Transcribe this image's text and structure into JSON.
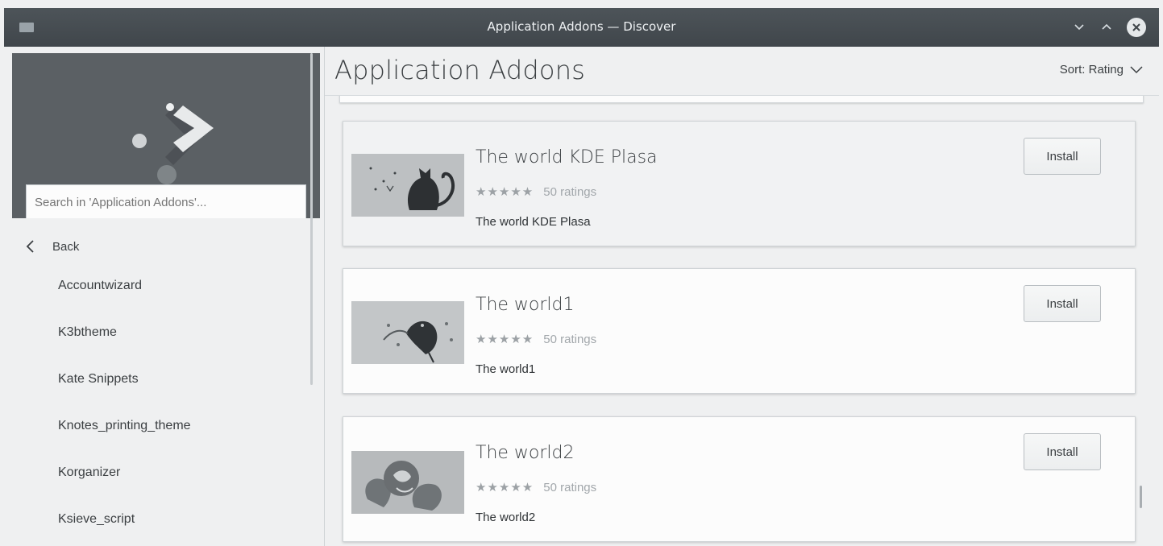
{
  "window": {
    "title": "Application Addons — Discover"
  },
  "sidebar": {
    "search_placeholder": "Search in 'Application Addons'...",
    "back_label": "Back",
    "categories": [
      {
        "label": "Accountwizard"
      },
      {
        "label": "K3btheme"
      },
      {
        "label": "Kate Snippets"
      },
      {
        "label": "Knotes_printing_theme"
      },
      {
        "label": "Korganizer"
      },
      {
        "label": "Ksieve_script"
      }
    ]
  },
  "main": {
    "title": "Application Addons",
    "sort_label": "Sort: Rating",
    "items": [
      {
        "name": "The world KDE Plasa",
        "ratings": "50 ratings",
        "summary": "The world KDE Plasa",
        "install_label": "Install",
        "stars": "★★★★★"
      },
      {
        "name": "The world1",
        "ratings": "50 ratings",
        "summary": "The world1",
        "install_label": "Install",
        "stars": "★★★★★"
      },
      {
        "name": "The world2",
        "ratings": "50 ratings",
        "summary": "The world2",
        "install_label": "Install",
        "stars": "★★★★★"
      }
    ]
  },
  "colors": {
    "titlebar": "#454b50",
    "sidebar_hero": "#5b6064",
    "accent": "#3daee9",
    "background": "#eff0f1"
  }
}
